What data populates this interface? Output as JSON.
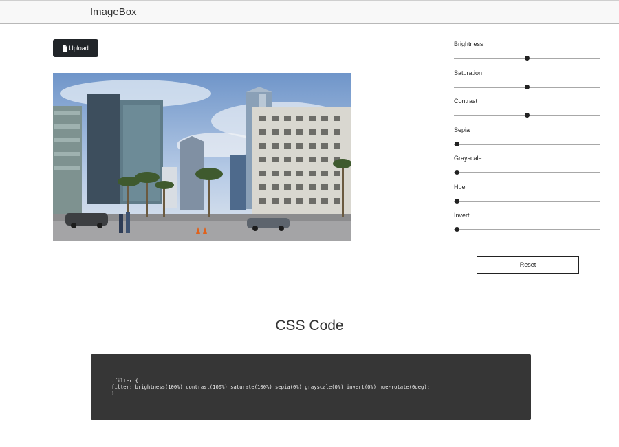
{
  "navbar": {
    "brand": "ImageBox"
  },
  "toolbar": {
    "upload_label": "Upload",
    "upload_icon": "file-icon"
  },
  "image": {
    "description_icon": "photo"
  },
  "filters": [
    {
      "label": "Brightness",
      "value": 50
    },
    {
      "label": "Saturation",
      "value": 50
    },
    {
      "label": "Contrast",
      "value": 50
    },
    {
      "label": "Sepia",
      "value": 0
    },
    {
      "label": "Grayscale",
      "value": 0
    },
    {
      "label": "Hue",
      "value": 0
    },
    {
      "label": "Invert",
      "value": 0
    }
  ],
  "reset_label": "Reset",
  "code_section": {
    "title": "CSS Code",
    "lines": [
      ".filter {",
      "filter: brightness(100%) contrast(100%) saturate(100%) sepia(0%) grayscale(0%) invert(0%) hue-rotate(0deg);",
      "}"
    ]
  },
  "colors": {
    "accent": "#212529",
    "code_bg": "#363636"
  }
}
